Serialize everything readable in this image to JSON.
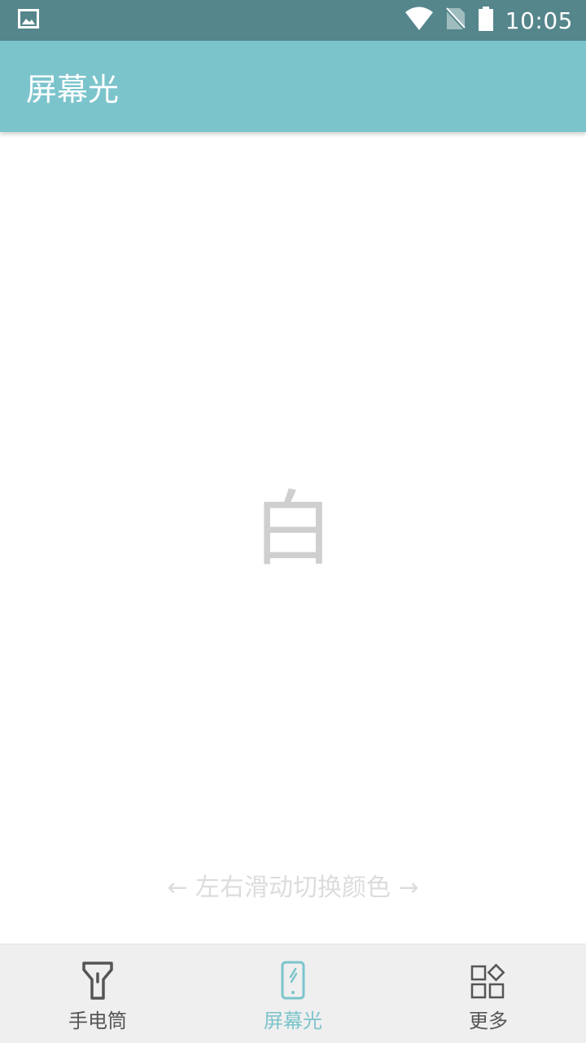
{
  "status_bar": {
    "time": "10:05",
    "icons": [
      "image-notification-icon",
      "wifi-icon",
      "no-sim-icon",
      "battery-icon"
    ]
  },
  "app_bar": {
    "title": "屏幕光"
  },
  "main": {
    "color_name": "白",
    "swipe_hint": "← 左右滑动切换颜色 →"
  },
  "bottom_nav": {
    "items": [
      {
        "label": "手电筒",
        "icon": "flashlight-icon",
        "active": false
      },
      {
        "label": "屏幕光",
        "icon": "phone-screen-icon",
        "active": true
      },
      {
        "label": "更多",
        "icon": "apps-grid-icon",
        "active": false
      }
    ]
  },
  "colors": {
    "status_bar": "#55868c",
    "app_bar": "#7cc4cc",
    "accent": "#7cc4cc",
    "nav_background": "#efefef",
    "nav_inactive": "#555555"
  }
}
